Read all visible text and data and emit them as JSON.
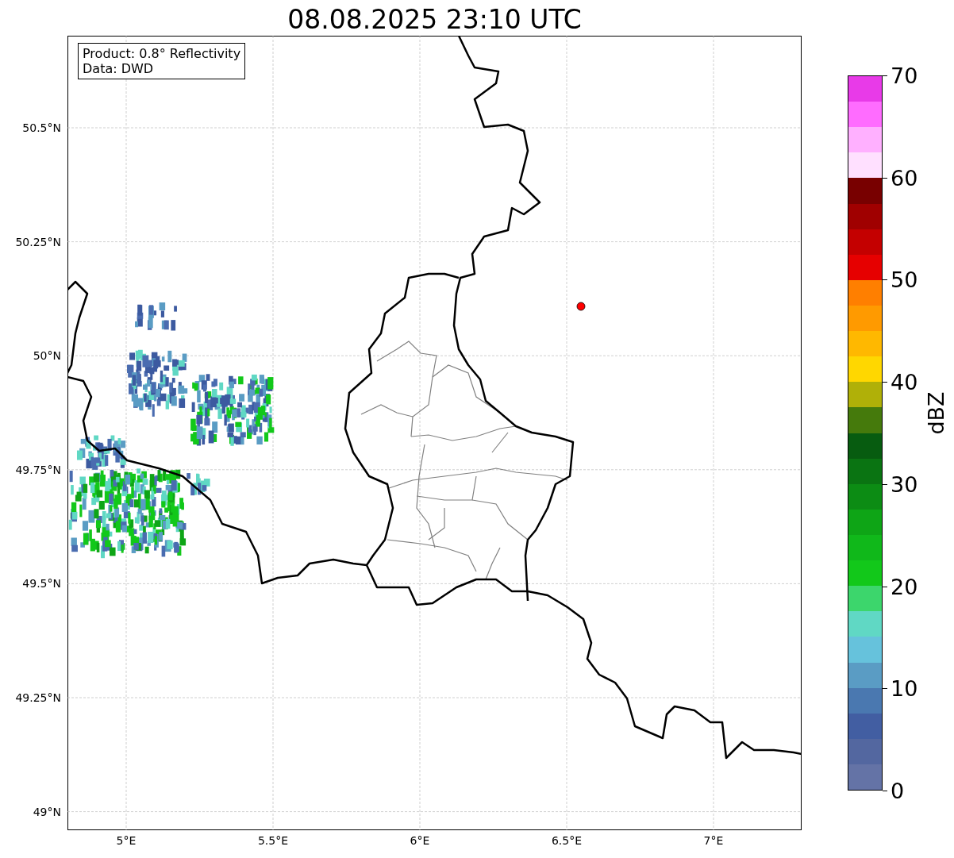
{
  "title": "08.08.2025 23:10 UTC",
  "info_box": [
    "Product: 0.8° Reflectivity",
    "Data: DWD"
  ],
  "map": {
    "lat_labels": [
      "50.5°N",
      "50.25°N",
      "50°N",
      "49.75°N",
      "49.5°N",
      "49.25°N",
      "49°N"
    ],
    "lon_labels": [
      "5°E",
      "5.5°E",
      "6°E",
      "6.5°E",
      "7°E"
    ]
  },
  "colorbar": {
    "label": "dBZ",
    "ticks": [
      "70",
      "60",
      "50",
      "40",
      "30",
      "20",
      "10",
      "0"
    ],
    "segments": [
      {
        "color": "#e83ae8"
      },
      {
        "color": "#ff6cff"
      },
      {
        "color": "#ffb0ff"
      },
      {
        "color": "#ffe0ff"
      },
      {
        "color": "#780000"
      },
      {
        "color": "#a00000"
      },
      {
        "color": "#c40000"
      },
      {
        "color": "#e60000"
      },
      {
        "color": "#ff7f00"
      },
      {
        "color": "#ff9a00"
      },
      {
        "color": "#ffb800"
      },
      {
        "color": "#ffd700"
      },
      {
        "color": "#b0b008"
      },
      {
        "color": "#457a0c"
      },
      {
        "color": "#075c10"
      },
      {
        "color": "#0a7412"
      },
      {
        "color": "#0c8c14"
      },
      {
        "color": "#0ea516"
      },
      {
        "color": "#10b81a"
      },
      {
        "color": "#12c81a"
      },
      {
        "color": "#3cd66c"
      },
      {
        "color": "#60d8c4"
      },
      {
        "color": "#66c2dc"
      },
      {
        "color": "#5a9cc4"
      },
      {
        "color": "#4a78b0"
      },
      {
        "color": "#425ea2"
      },
      {
        "color": "#5367a0"
      },
      {
        "color": "#6473a6"
      }
    ]
  }
}
